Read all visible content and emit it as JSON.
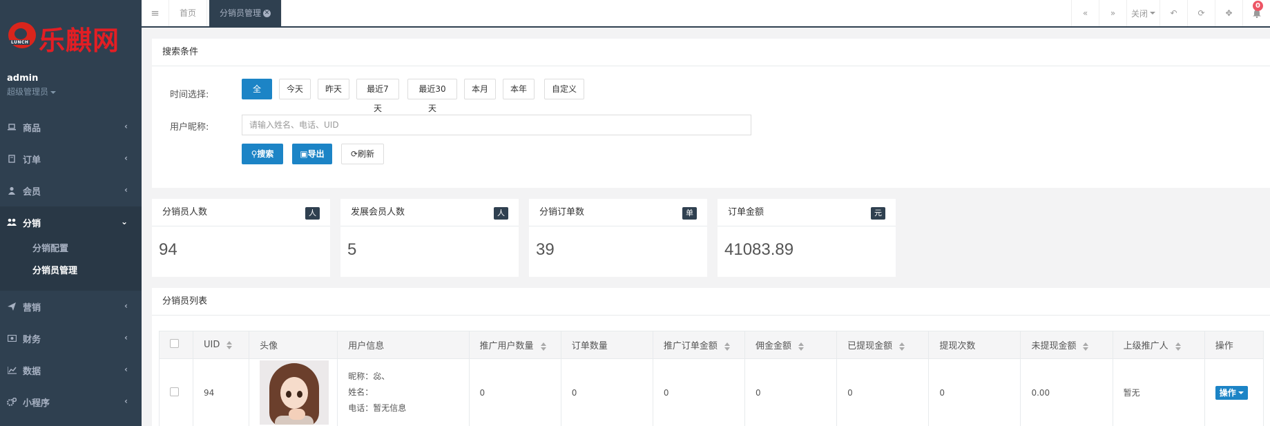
{
  "brand": {
    "logo_text": "乐麒网",
    "logo_sub": "LUNCH"
  },
  "user": {
    "name": "admin",
    "role": "超级管理员"
  },
  "sidebar": {
    "items": [
      {
        "label": "商品",
        "icon": "laptop-icon"
      },
      {
        "label": "订单",
        "icon": "book-icon"
      },
      {
        "label": "会员",
        "icon": "user-icon"
      },
      {
        "label": "分销",
        "icon": "users-icon",
        "active": true,
        "children": [
          "分销配置",
          "分销员管理"
        ]
      },
      {
        "label": "营销",
        "icon": "paper-plane-icon"
      },
      {
        "label": "财务",
        "icon": "money-icon"
      },
      {
        "label": "数据",
        "icon": "line-chart-icon"
      },
      {
        "label": "小程序",
        "icon": "cogs-icon"
      }
    ]
  },
  "topbar": {
    "tabs": [
      {
        "label": "首页"
      },
      {
        "label": "分销员管理",
        "active": true
      }
    ],
    "close_label": "关闭",
    "notify_count": "0"
  },
  "search": {
    "title": "搜索条件",
    "time_label": "时间选择:",
    "time_options": [
      "全部",
      "今天",
      "昨天",
      "最近7天",
      "最近30天",
      "本月",
      "本年",
      "自定义"
    ],
    "nick_label": "用户昵称:",
    "nick_placeholder": "请输入姓名、电话、UID",
    "search_btn": "搜索",
    "export_btn": "导出",
    "refresh_btn": "刷新"
  },
  "stats": [
    {
      "title": "分销员人数",
      "unit": "人",
      "value": "94"
    },
    {
      "title": "发展会员人数",
      "unit": "人",
      "value": "5"
    },
    {
      "title": "分销订单数",
      "unit": "单",
      "value": "39"
    },
    {
      "title": "订单金额",
      "unit": "元",
      "value": "41083.89"
    }
  ],
  "list": {
    "title": "分销员列表",
    "columns": [
      "UID",
      "头像",
      "用户信息",
      "推广用户数量",
      "订单数量",
      "推广订单金额",
      "佣金金额",
      "已提现金额",
      "提现次数",
      "未提现金额",
      "上级推广人",
      "操作"
    ],
    "rows": [
      {
        "uid": "94",
        "nickname": "昵称：惢、",
        "realname": "姓名：",
        "phone": "电话：暂无信息",
        "promo_users": "0",
        "orders": "0",
        "promo_amount": "0",
        "commission": "0",
        "withdrawn": "0",
        "withdraw_times": "0",
        "unwithdrawn": "0.00",
        "parent": "暂无",
        "action": "操作"
      }
    ]
  },
  "colors": {
    "sidebar_bg": "#2f4050",
    "primary": "#1c84c6",
    "badge": "#ed5565"
  }
}
